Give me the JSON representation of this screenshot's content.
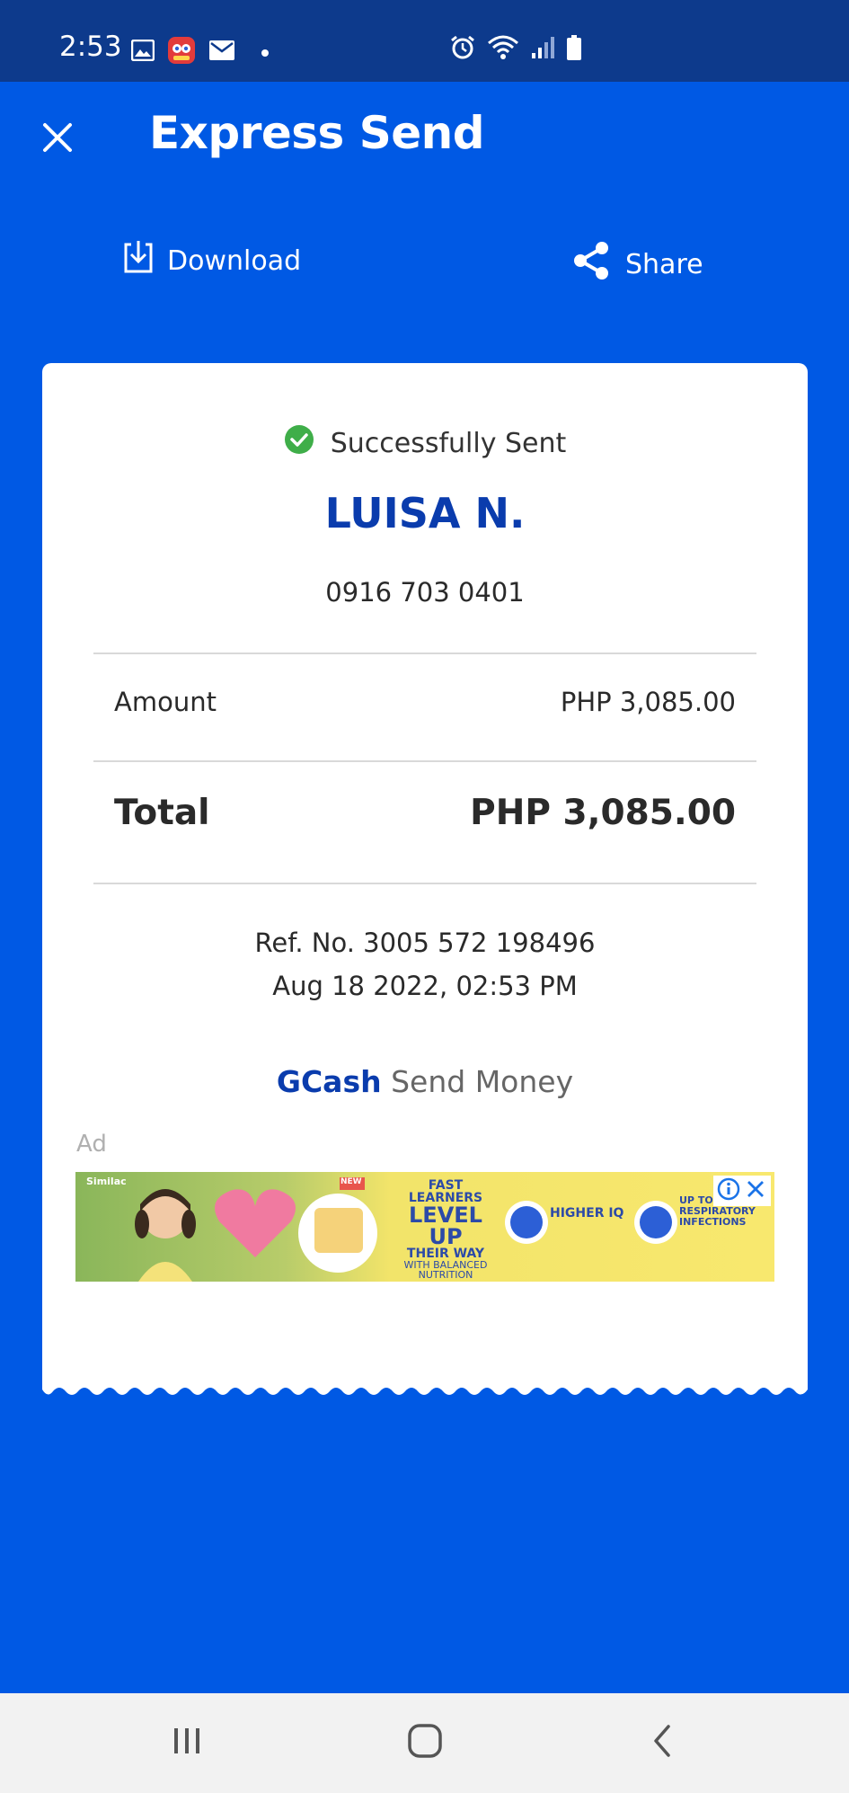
{
  "status_bar": {
    "time": "2:53",
    "left_icons": [
      "image-icon",
      "app-notification-icon",
      "mail-icon",
      "dot-icon"
    ],
    "right_icons": [
      "alarm-icon",
      "wifi-icon",
      "signal-icon",
      "battery-icon"
    ]
  },
  "header": {
    "title": "Express Send",
    "close_icon": "close-icon"
  },
  "actions": {
    "download_label": "Download",
    "share_label": "Share"
  },
  "receipt": {
    "status_text": "Successfully Sent",
    "recipient_name": "LUISA N.",
    "recipient_number": "0916 703 0401",
    "amount_label": "Amount",
    "amount_value": "PHP 3,085.00",
    "total_label": "Total",
    "total_value": "PHP 3,085.00",
    "ref_no": "Ref. No. 3005 572 198496",
    "datetime": "Aug 18 2022, 02:53 PM",
    "brand_strong": "GCash",
    "brand_rest": "Send Money"
  },
  "ad": {
    "label": "Ad",
    "brand_small": "Similac",
    "headline_top": "FAST LEARNERS",
    "headline_main": "LEVEL UP",
    "headline_bottom": "THEIR WAY",
    "headline_sub": "WITH BALANCED NUTRITION",
    "badge_new": "NEW",
    "higher_text": "HIGHER IQ",
    "up_text": "UP TO ... LESS RESPIRATORY INFECTIONS"
  },
  "colors": {
    "primary_blue": "#0059e4",
    "status_bar_blue": "#0d3a8c",
    "name_blue": "#0a3cad",
    "success_green": "#3fae49"
  },
  "nav": {
    "recent_icon": "recent-apps-icon",
    "home_icon": "home-icon",
    "back_icon": "back-icon"
  }
}
